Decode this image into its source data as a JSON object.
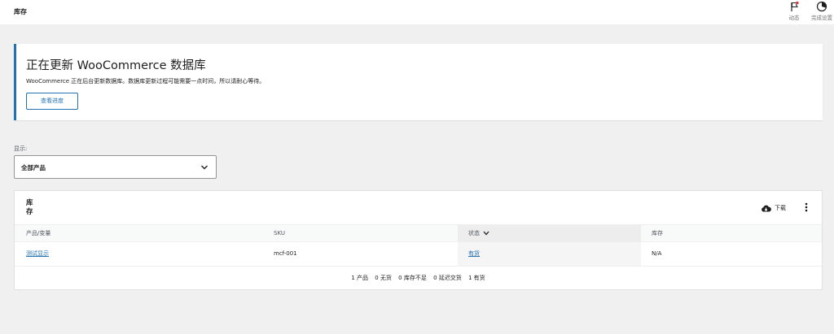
{
  "header": {
    "title": "库存",
    "activity_label": "动态",
    "setup_label": "完成设置"
  },
  "notice": {
    "title": "正在更新 WooCommerce 数据库",
    "message": "WooCommerce 正在后台更新数据库。数据库更新过程可能需要一点时间，所以请耐心等待。",
    "button_label": "查看进度"
  },
  "filter": {
    "label": "显示:",
    "selected": "全部产品"
  },
  "stock_card": {
    "title_line1": "库",
    "title_line2": "存",
    "download_label": "下载",
    "columns": {
      "product": "产品/变量",
      "sku": "SKU",
      "status": "状态",
      "stock": "库存"
    },
    "rows": [
      {
        "product": "测试显示",
        "sku": "mcf-001",
        "status": "有货",
        "stock": "N/A"
      }
    ],
    "summary": {
      "products": "1 产品",
      "out_of_stock": "0 无货",
      "low_stock": "0 库存不足",
      "on_backorder": "0 延迟交货",
      "in_stock": "1 有货"
    }
  },
  "colors": {
    "accent": "#2271b1",
    "background": "#f0f0f1",
    "flag": "#d63638"
  },
  "icons": {
    "activity": "flag-icon",
    "setup": "progress-circle-icon",
    "download": "cloud-download-icon",
    "more": "vertical-ellipsis-icon",
    "select": "chevron-down-icon",
    "sort": "chevron-down-icon"
  }
}
